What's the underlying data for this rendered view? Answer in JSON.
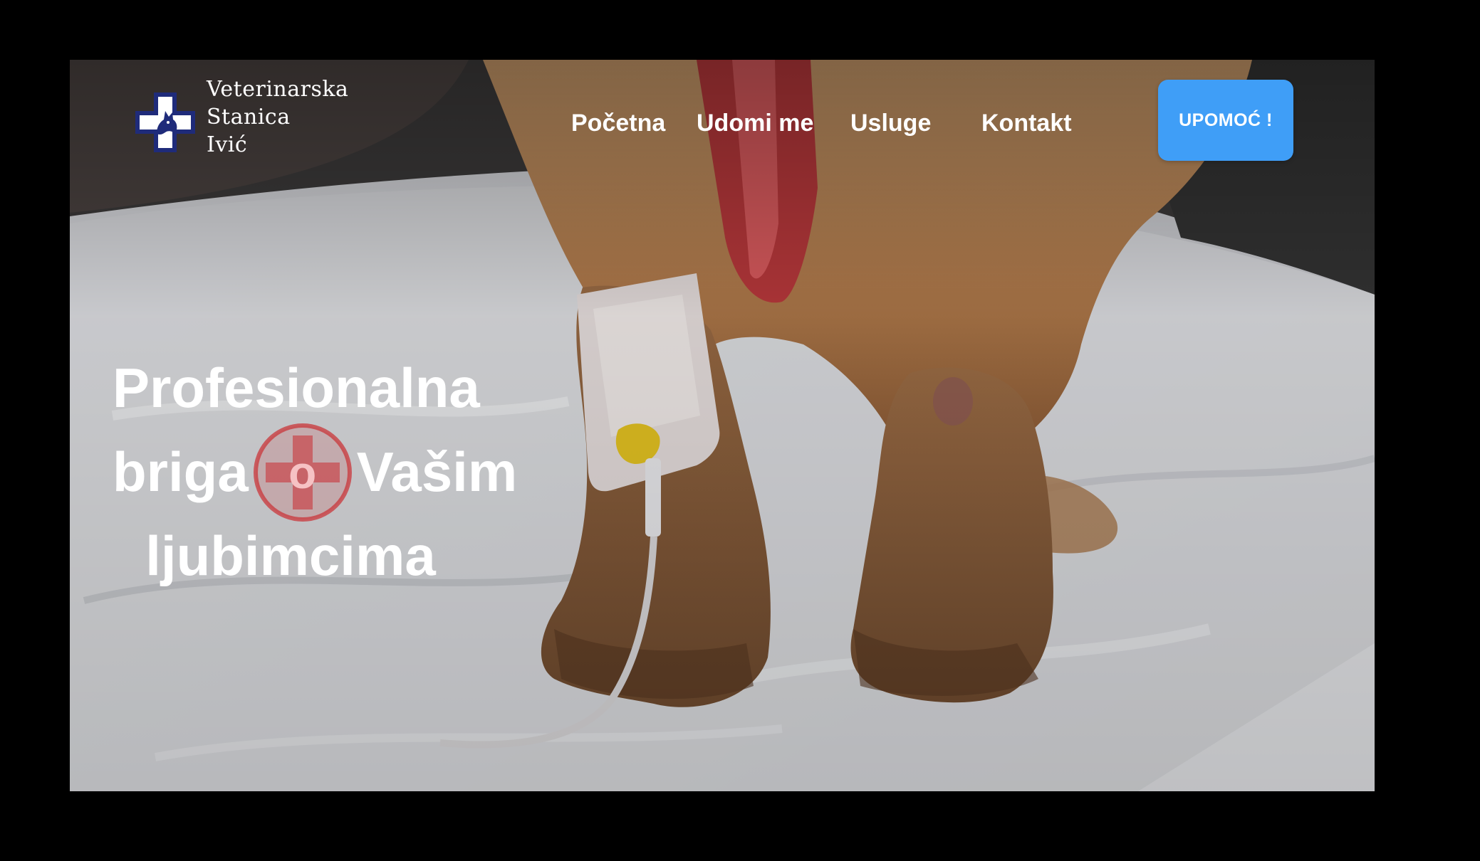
{
  "brand": {
    "name_lines": [
      "Veterinarska",
      "Stanica",
      "Ivić"
    ],
    "logo_icon": "medical-cross-dog-icon",
    "colors": {
      "logo_blue": "#1f2b7a",
      "cta_blue": "#3f9ef7",
      "cross_red": "#c9353a"
    }
  },
  "nav": {
    "items": [
      {
        "label": "Početna"
      },
      {
        "label": "Udomi me"
      },
      {
        "label": "Usluge"
      },
      {
        "label": "Kontakt"
      }
    ]
  },
  "cta": {
    "label": "UPOMOĆ !"
  },
  "hero": {
    "line1": "Profesionalna",
    "line2_start": "briga",
    "line2_badge_letter": "o",
    "line2_end": "Vašim",
    "line3": "ljubimcima",
    "badge_icon": "red-cross-circle-icon",
    "background": "dog-paws-with-iv-catheter-photo"
  }
}
